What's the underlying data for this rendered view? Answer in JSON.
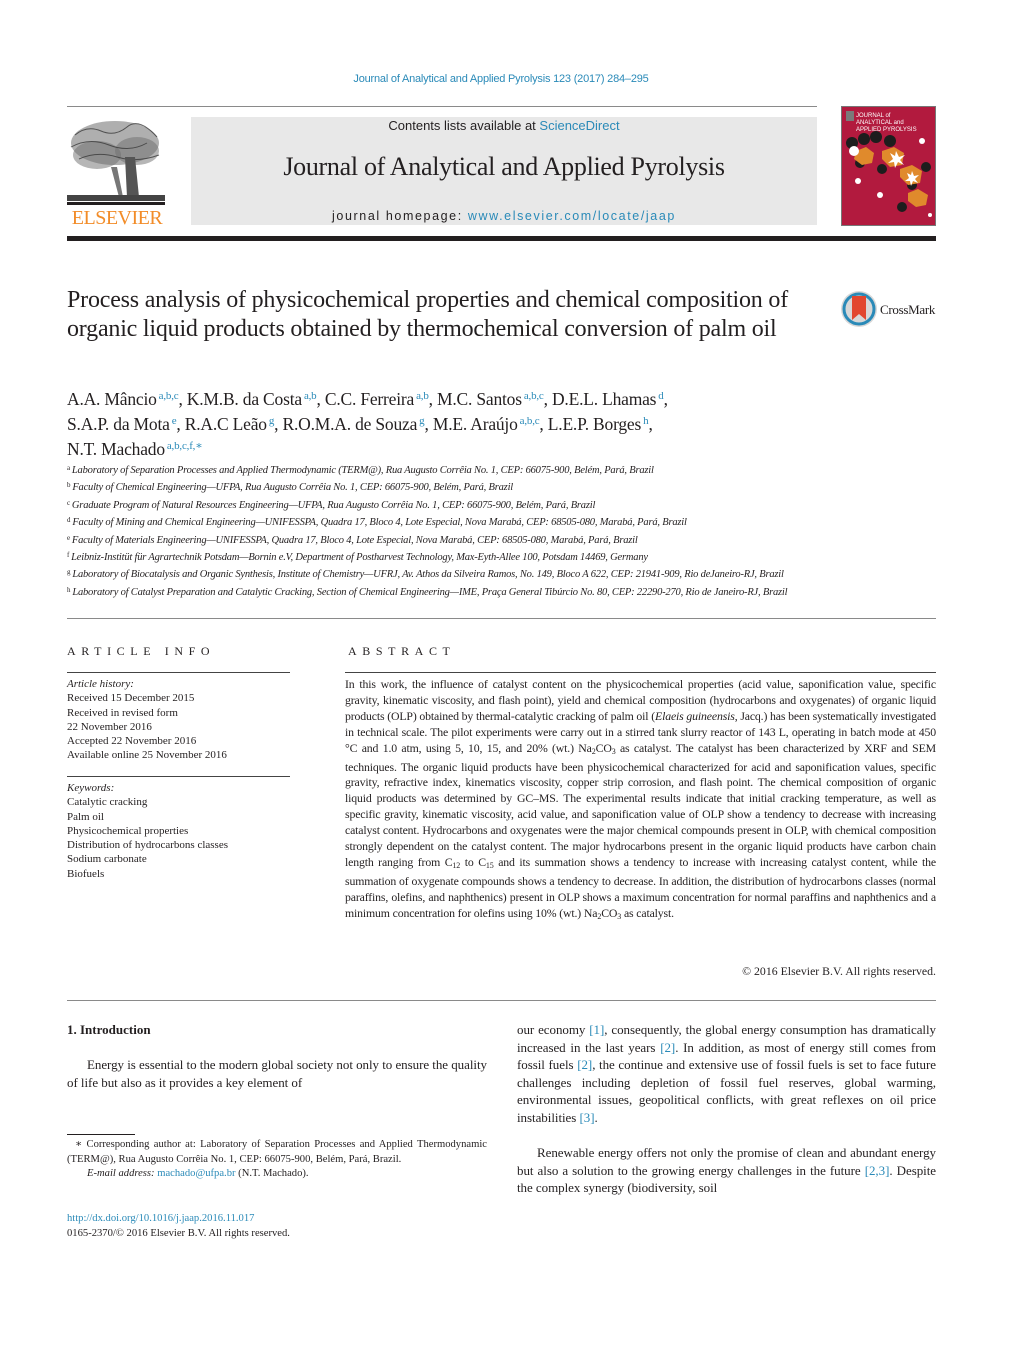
{
  "header": {
    "citation": "Journal of Analytical and Applied Pyrolysis 123 (2017) 284–295",
    "contents_prefix": "Contents lists available at ",
    "contents_link": "ScienceDirect",
    "journal_name": "Journal of Analytical and Applied Pyrolysis",
    "homepage_prefix": "journal homepage: ",
    "homepage_link": "www.elsevier.com/locate/jaap",
    "publisher_logo": "ELSEVIER",
    "cover_lines": [
      "JOURNAL of",
      "ANALYTICAL and",
      "APPLIED PYROLYSIS"
    ],
    "colors": {
      "link": "#2a8ab8",
      "elsevier_orange": "#f28c28",
      "cover_red": "#b21a3e",
      "cover_orange": "#e08a2c"
    }
  },
  "article": {
    "title": "Process analysis of physicochemical properties and chemical composition of organic liquid products obtained by thermochemical conversion of palm oil",
    "crossmark_label": "CrossMark",
    "authors": [
      {
        "name": "A.A. Mâncio",
        "sup": "a,b,c",
        "sep": ", "
      },
      {
        "name": "K.M.B. da Costa",
        "sup": "a,b",
        "sep": ", "
      },
      {
        "name": "C.C. Ferreira",
        "sup": "a,b",
        "sep": ", "
      },
      {
        "name": "M.C. Santos",
        "sup": "a,b,c",
        "sep": ", "
      },
      {
        "name": "D.E.L. Lhamas",
        "sup": "d",
        "sep": ","
      },
      {
        "name": "S.A.P. da Mota",
        "sup": "e",
        "sep": ", "
      },
      {
        "name": "R.A.C Leão",
        "sup": "g",
        "sep": ", "
      },
      {
        "name": "R.O.M.A. de Souza",
        "sup": "g",
        "sep": ", "
      },
      {
        "name": "M.E. Araújo",
        "sup": "a,b,c",
        "sep": ", "
      },
      {
        "name": "L.E.P. Borges",
        "sup": "h",
        "sep": ","
      },
      {
        "name": "N.T. Machado",
        "sup": "a,b,c,f,∗",
        "sep": ""
      }
    ],
    "affiliations": [
      {
        "key": "a",
        "text": "Laboratory of Separation Processes and Applied Thermodynamic (TERM@), Rua Augusto Corrêia No. 1, CEP: 66075-900, Belém, Pará, Brazil"
      },
      {
        "key": "b",
        "text": "Faculty of Chemical Engineering—UFPA, Rua Augusto Corrêia No. 1, CEP: 66075-900, Belém, Pará, Brazil"
      },
      {
        "key": "c",
        "text": "Graduate Program of Natural Resources Engineering—UFPA, Rua Augusto Corrêia No. 1, CEP: 66075-900, Belém, Pará, Brazil"
      },
      {
        "key": "d",
        "text": "Faculty of Mining and Chemical Engineering—UNIFESSPA, Quadra 17, Bloco 4, Lote Especial, Nova Marabá, CEP: 68505-080, Marabá, Pará, Brazil"
      },
      {
        "key": "e",
        "text": "Faculty of Materials Engineering—UNIFESSPA, Quadra 17, Bloco 4, Lote Especial, Nova Marabá, CEP: 68505-080, Marabá, Pará, Brazil"
      },
      {
        "key": "f",
        "text": "Leibniz-Institüt für Agrartechnik Potsdam—Bornin e.V, Department of Postharvest Technology, Max-Eyth-Allee 100, Potsdam 14469, Germany"
      },
      {
        "key": "g",
        "text": "Laboratory of Biocatalysis and Organic Synthesis, Institute of Chemistry—UFRJ, Av. Athos da Silveira Ramos, No. 149, Bloco A 622, CEP: 21941-909, Rio deJaneiro-RJ, Brazil"
      },
      {
        "key": "h",
        "text": "Laboratory of Catalyst Preparation and Catalytic Cracking, Section of Chemical Engineering—IME, Praça General Tibúrcio No. 80, CEP: 22290-270, Rio de Janeiro-RJ, Brazil"
      }
    ]
  },
  "article_info": {
    "heading": "ARTICLE INFO",
    "history_label": "Article history:",
    "history": [
      "Received 15 December 2015",
      "Received in revised form",
      "22 November 2016",
      "Accepted 22 November 2016",
      "Available online 25 November 2016"
    ],
    "keywords_label": "Keywords:",
    "keywords": [
      "Catalytic cracking",
      "Palm oil",
      "Physicochemical properties",
      "Distribution of hydrocarbons classes",
      "Sodium carbonate",
      "Biofuels"
    ]
  },
  "abstract": {
    "heading": "ABSTRACT",
    "p1": "In this work, the influence of catalyst content on the physicochemical properties (acid value, saponification value, specific gravity, kinematic viscosity, and flash point), yield and chemical composition (hydrocarbons and oxygenates) of organic liquid products (OLP) obtained by thermal-catalytic cracking of palm oil (",
    "species": "Elaeis guineensis",
    "p2": ", Jacq.) has been systematically investigated in technical scale. The pilot experiments were carry out in a stirred tank slurry reactor of 143 L, operating in batch mode at 450 °C and 1.0 atm, using 5, 10, 15, and 20% (wt.) Na",
    "p3": "CO",
    "p4": " as catalyst. The catalyst has been characterized by XRF and SEM techniques. The organic liquid products have been physicochemical characterized for acid and saponification values, specific gravity, refractive index, kinematics viscosity, copper strip corrosion, and flash point. The chemical composition of organic liquid products was determined by GC–MS. The experimental results indicate that initial cracking temperature, as well as specific gravity, kinematic viscosity, acid value, and saponification value of OLP show a tendency to decrease with increasing catalyst content. Hydrocarbons and oxygenates were the major chemical compounds present in OLP, with chemical composition strongly dependent on the catalyst content. The major hydrocarbons present in the organic liquid products have carbon chain length ranging from C",
    "sub12": "12",
    "p5": " to C",
    "sub15": "15",
    "p6": " and its summation shows a tendency to increase with increasing catalyst content, while the summation of oxygenate compounds shows a tendency to decrease. In addition, the distribution of hydrocarbons classes (normal paraffins, olefins, and naphthenics) present in OLP shows a maximum concentration for normal paraffins and naphthenics and a minimum concentration for olefins using 10% (wt.) Na",
    "p7": "CO",
    "p8": " as catalyst.",
    "sub2": "2",
    "sub3": "3",
    "copyright": "© 2016 Elsevier B.V. All rights reserved."
  },
  "introduction": {
    "heading": "1.  Introduction",
    "left_p1": "Energy is essential to the modern global society not only to ensure the quality of life but also as it provides a key element of",
    "right_p1_a": "our economy ",
    "ref1": "[1]",
    "right_p1_b": ", consequently, the global energy consumption has dramatically increased in the last years ",
    "ref2": "[2]",
    "right_p1_c": ". In addition, as most of energy still comes from fossil fuels ",
    "ref2b": "[2]",
    "right_p1_d": ", the continue and extensive use of fossil fuels is set to face future challenges including depletion of fossil fuel reserves, global warming, environmental issues, geopolitical conflicts, with great reflexes on oil price instabilities ",
    "ref3": "[3]",
    "right_p1_e": ".",
    "right_p2_a": "Renewable energy offers not only the promise of clean and abundant energy but also a solution to the growing energy challenges in the future ",
    "ref23": "[2,3]",
    "right_p2_b": ". Despite the complex synergy (biodiversity, soil"
  },
  "footnote": {
    "corresponding": "∗  Corresponding author at: Laboratory of Separation Processes and Applied Thermodynamic (TERM@), Rua Augusto Corrêia No. 1, CEP: 66075-900, Belém, Pará, Brazil.",
    "email_label": "E-mail address: ",
    "email": "machado@ufpa.br",
    "email_suffix": " (N.T. Machado).",
    "doi": "http://dx.doi.org/10.1016/j.jaap.2016.11.017",
    "issn": "0165-2370/© 2016 Elsevier B.V. All rights reserved."
  }
}
